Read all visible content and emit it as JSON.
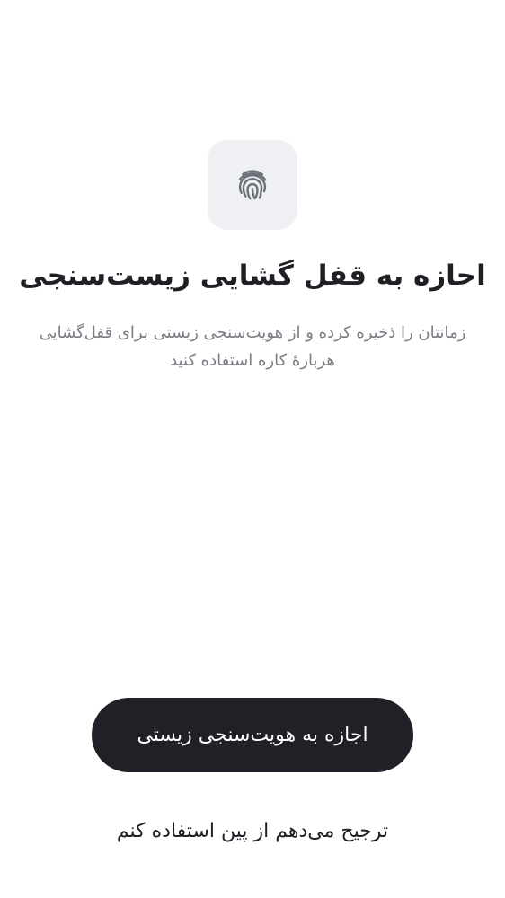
{
  "icon": {
    "name": "fingerprint-icon",
    "tile_color": "#eff0f3",
    "stroke_color": "#6d7078"
  },
  "title": "احازه به قفل گشایی زیست‌سنجی",
  "subtitle": "زمانتان را ذخیره کرده و از هویت‌سنجی زیستی برای قفل‌گشایی هربارهٔ کاره استفاده کنید",
  "primary_button": {
    "label": "اجازه به هویت‌سنجی زیستی",
    "background": "#1f2127"
  },
  "secondary_link": {
    "label": "ترجیح می‌دهم از پین استفاده کنم"
  }
}
